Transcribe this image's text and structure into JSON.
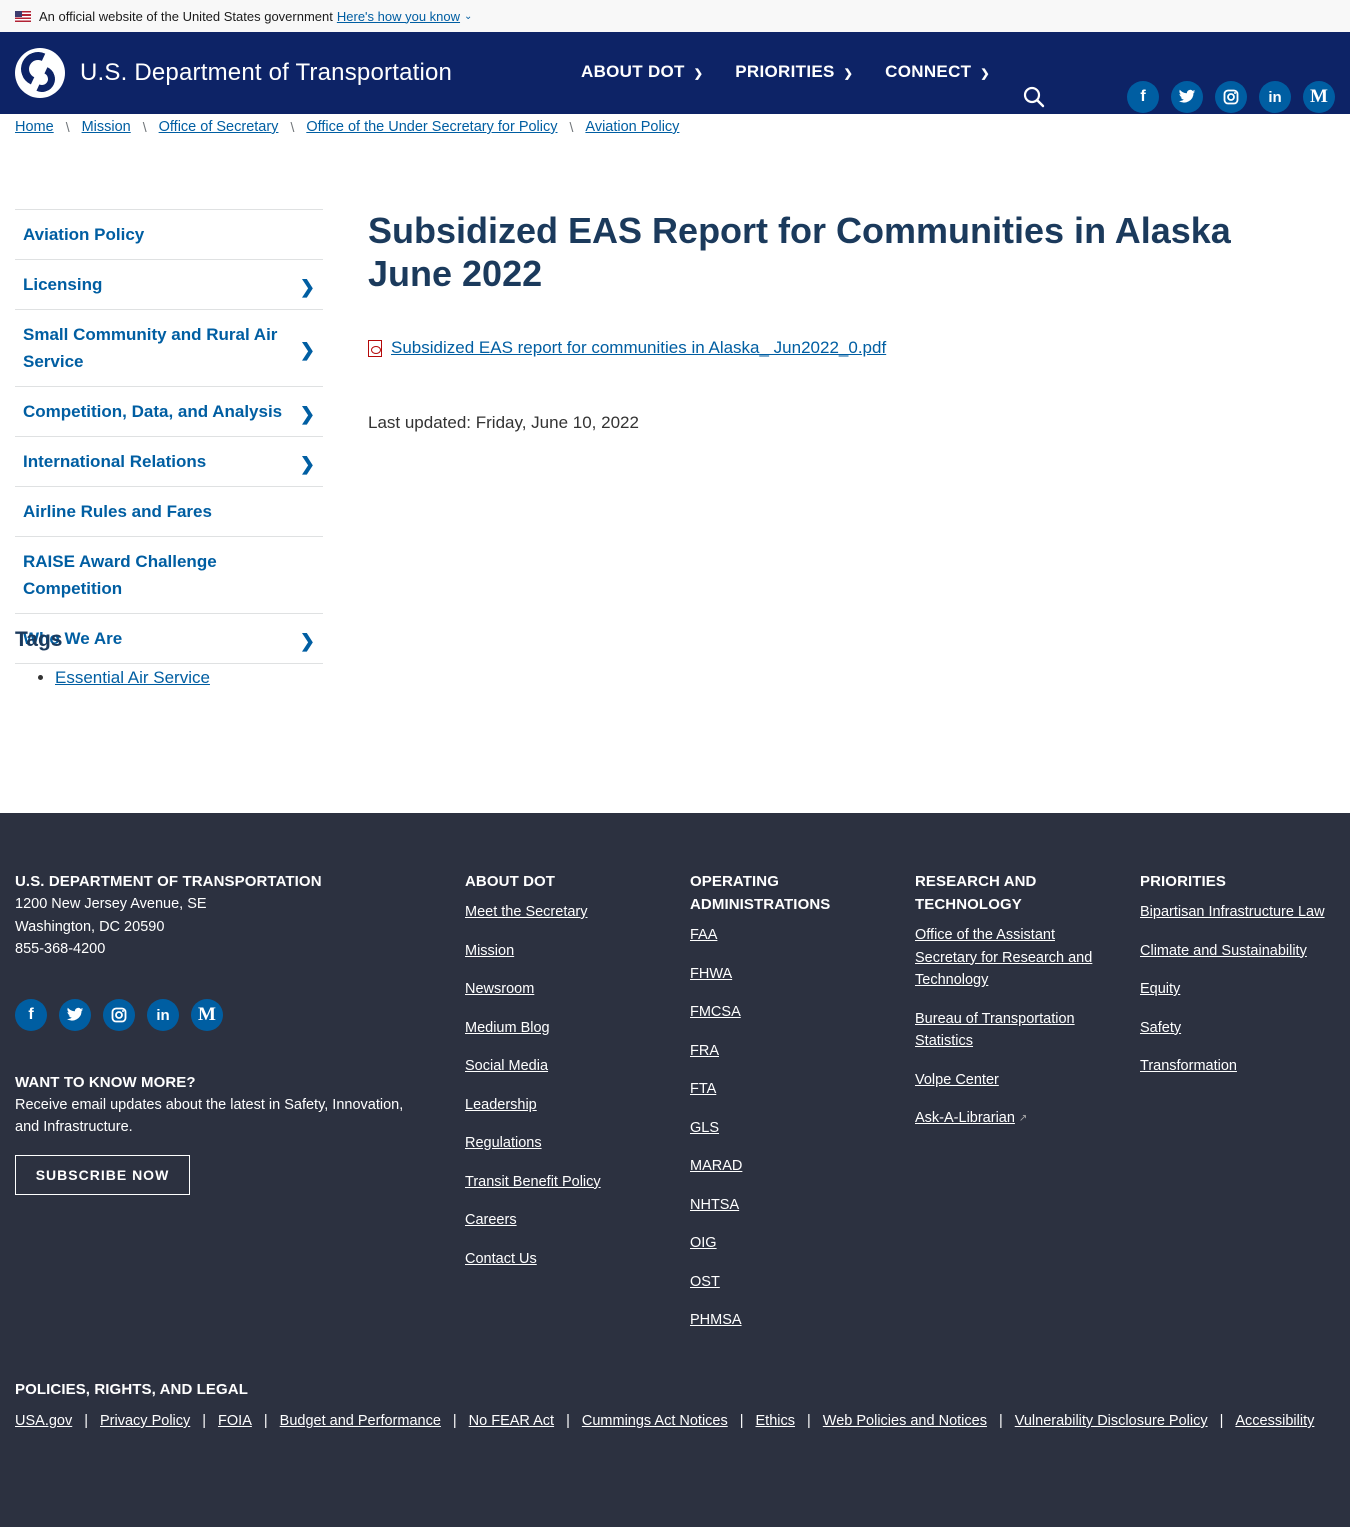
{
  "gov_banner": {
    "text": "An official website of the United States government",
    "link": "Here's how you know"
  },
  "header": {
    "site_title": "U.S. Department of Transportation",
    "nav": [
      "ABOUT DOT",
      "PRIORITIES",
      "CONNECT"
    ],
    "social": [
      "f",
      "t",
      "ig",
      "in",
      "M"
    ]
  },
  "breadcrumb": [
    "Home",
    "Mission",
    "Office of Secretary",
    "Office of the Under Secretary for Policy",
    "Aviation Policy"
  ],
  "sidebar": {
    "items": [
      {
        "label": "Aviation Policy"
      },
      {
        "label": "Licensing"
      },
      {
        "label": "Small Community and Rural Air Service"
      },
      {
        "label": "Competition, Data, and Analysis"
      },
      {
        "label": "International Relations"
      },
      {
        "label": "Airline Rules and Fares"
      },
      {
        "label": "RAISE Award Challenge Competition"
      },
      {
        "label": "Who We Are"
      }
    ],
    "tags_title": "Tags",
    "tags": [
      "Essential Air Service"
    ]
  },
  "main": {
    "title": "Subsidized EAS Report for Communities in Alaska June 2022",
    "file_link": "Subsidized EAS report for communities in Alaska_ Jun2022_0.pdf",
    "last_updated": "Last updated: Friday, June 10, 2022"
  },
  "footer": {
    "org_title": "U.S. DEPARTMENT OF TRANSPORTATION",
    "address1": "1200 New Jersey Avenue, SE",
    "address2": "Washington, DC 20590",
    "phone": "855-368-4200",
    "want_title": "WANT TO KNOW MORE?",
    "want_text": "Receive email updates about the latest in Safety, Innovation, and Infrastructure.",
    "subscribe": "SUBSCRIBE NOW",
    "about_title": "ABOUT DOT",
    "about_links": [
      "Meet the Secretary",
      "Mission",
      "Newsroom",
      "Medium Blog",
      "Social Media",
      "Leadership",
      "Regulations",
      "Transit Benefit Policy",
      "Careers",
      "Contact Us"
    ],
    "ops_title": "OPERATING ADMINISTRATIONS",
    "ops_links": [
      "FAA",
      "FHWA",
      "FMCSA",
      "FRA",
      "FTA",
      "GLS",
      "MARAD",
      "NHTSA",
      "OIG",
      "OST",
      "PHMSA"
    ],
    "research_title": "RESEARCH AND TECHNOLOGY",
    "research_links": [
      "Office of the Assistant Secretary for Research and Technology",
      "Bureau of Transportation Statistics",
      "Volpe Center",
      "Ask-A-Librarian"
    ],
    "priorities_title": "PRIORITIES",
    "priorities_links": [
      "Bipartisan Infrastructure Law",
      "Climate and Sustainability",
      "Equity",
      "Safety",
      "Transformation"
    ],
    "legal_title": "POLICIES, RIGHTS, AND LEGAL",
    "legal_links": [
      "USA.gov",
      "Privacy Policy",
      "FOIA",
      "Budget and Performance",
      "No FEAR Act",
      "Cummings Act Notices",
      "Ethics",
      "Web Policies and Notices",
      "Vulnerability Disclosure Policy",
      "Accessibility"
    ]
  }
}
